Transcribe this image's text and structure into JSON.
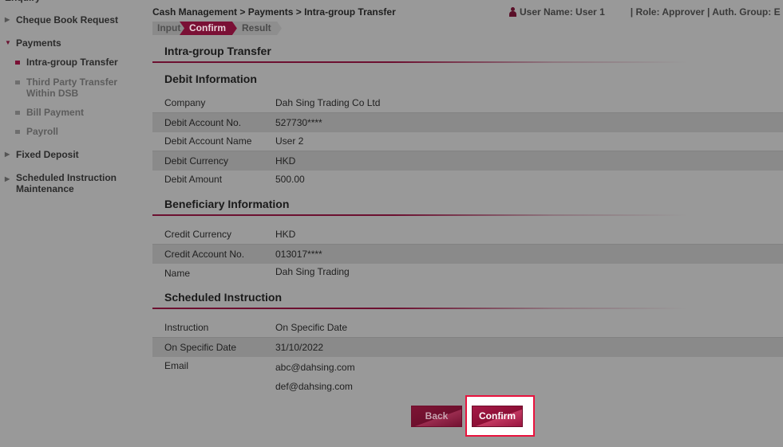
{
  "sidebar": {
    "partial_top": "Enquiry",
    "items": [
      {
        "label": "Cheque Book Request",
        "expanded": false
      },
      {
        "label": "Payments",
        "expanded": true,
        "children": [
          {
            "label": "Intra-group Transfer",
            "active": true
          },
          {
            "label": "Third Party Transfer Within DSB",
            "line1": "Third Party Transfer",
            "line2": "Within DSB"
          },
          {
            "label": "Bill Payment"
          },
          {
            "label": "Payroll"
          }
        ]
      },
      {
        "label": "Fixed Deposit",
        "expanded": false
      },
      {
        "label": "Scheduled Instruction Maintenance",
        "line1": "Scheduled Instruction",
        "line2": "Maintenance",
        "expanded": false
      }
    ]
  },
  "header": {
    "breadcrumb": "Cash Management > Payments > Intra-group Transfer",
    "user_label": "User Name:",
    "user_name": "User 1",
    "role_info": "| Role: Approver | Auth. Group: E"
  },
  "steps": [
    "Input",
    "Confirm",
    "Result"
  ],
  "current_step": "Confirm",
  "page_title": "Intra-group Transfer",
  "sections": {
    "debit": {
      "title": "Debit Information",
      "rows": [
        {
          "label": "Company",
          "value": "Dah Sing Trading Co Ltd"
        },
        {
          "label": "Debit Account No.",
          "value": "527730****"
        },
        {
          "label": "Debit Account Name",
          "value": "User 2"
        },
        {
          "label": "Debit Currency",
          "value": "HKD"
        },
        {
          "label": "Debit Amount",
          "value": "500.00"
        }
      ]
    },
    "beneficiary": {
      "title": "Beneficiary Information",
      "rows": [
        {
          "label": "Credit Currency",
          "value": "HKD"
        },
        {
          "label": "Credit Account No.",
          "value": "013017****"
        },
        {
          "label": "Name",
          "value": "Dah Sing Trading"
        }
      ]
    },
    "scheduled": {
      "title": "Scheduled Instruction",
      "rows": [
        {
          "label": "Instruction",
          "value": "On Specific Date"
        },
        {
          "label": "On Specific Date",
          "value": "31/10/2022"
        },
        {
          "label": "Email",
          "value": "abc@dahsing.com"
        },
        {
          "label": "",
          "value": "def@dahsing.com"
        }
      ]
    }
  },
  "buttons": {
    "back": "Back",
    "confirm": "Confirm"
  },
  "colors": {
    "brand": "#7a1035",
    "highlight": "#e8123d",
    "overlay_bg": "#999999"
  }
}
